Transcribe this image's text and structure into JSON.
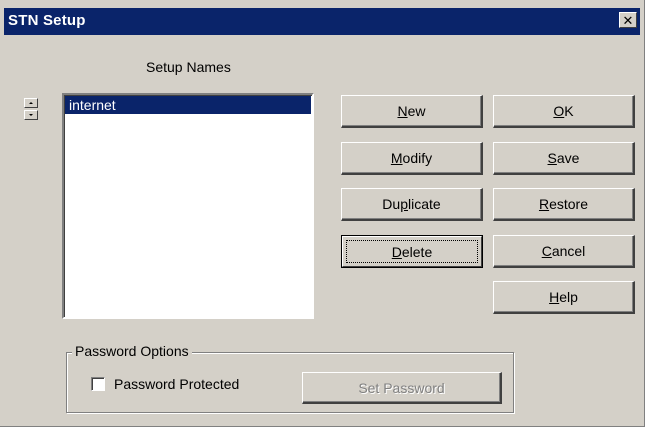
{
  "window": {
    "title": "STN Setup",
    "close_glyph": "✕"
  },
  "setup_names": {
    "label": "Setup Names",
    "items": [
      "internet"
    ],
    "selected_index": 0
  },
  "buttons": {
    "new": {
      "pre": "",
      "key": "N",
      "post": "ew"
    },
    "modify": {
      "pre": "",
      "key": "M",
      "post": "odify"
    },
    "duplicate": {
      "pre": "Du",
      "key": "p",
      "post": "licate"
    },
    "delete": {
      "pre": "",
      "key": "D",
      "post": "elete"
    },
    "ok": {
      "pre": "",
      "key": "O",
      "post": "K"
    },
    "save": {
      "pre": "",
      "key": "S",
      "post": "ave"
    },
    "restore": {
      "pre": "",
      "key": "R",
      "post": "estore"
    },
    "cancel": {
      "pre": "",
      "key": "C",
      "post": "ancel"
    },
    "help": {
      "pre": "",
      "key": "H",
      "post": "elp"
    }
  },
  "password_options": {
    "legend": "Password Options",
    "checkbox_label": "Password Protected",
    "checked": false,
    "set_password_label": "Set Password"
  },
  "colors": {
    "titlebar": "#0a246a",
    "face": "#d4d0c8",
    "selection": "#0a246a"
  },
  "icons": {
    "close": "close-icon",
    "spin_up": "arrow-up-icon",
    "spin_down": "arrow-down-icon"
  }
}
